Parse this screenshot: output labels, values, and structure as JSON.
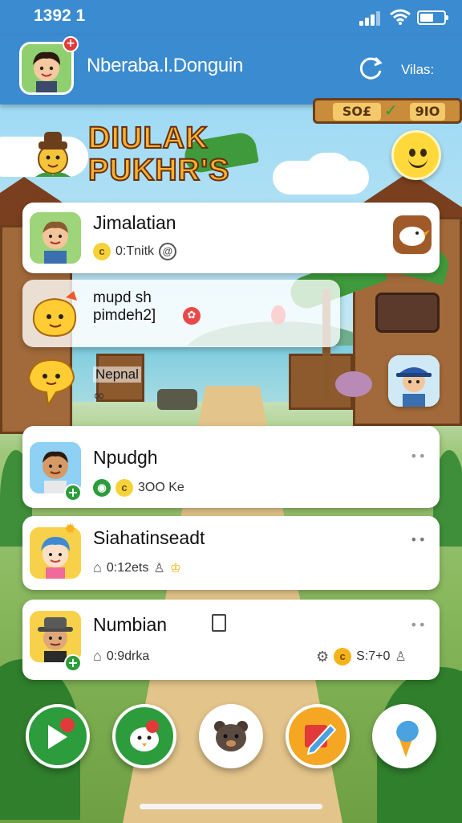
{
  "status_bar": {
    "time": "1392 1"
  },
  "header": {
    "title": "Nberaba.l.Donguin",
    "right_label": "Vilas:",
    "badge": "+"
  },
  "banner": {
    "logo_line1": "DIULAK",
    "logo_line2": "PUKHR'S",
    "score_left": "SO£",
    "score_right": "9IO"
  },
  "cards": [
    {
      "title": "Jimalatian",
      "subtitle": "0:Tnitk"
    },
    {
      "title_line1": "mupd sh",
      "title_line2": "pimdeh2]"
    },
    {
      "title": "Nepnal"
    },
    {
      "title": "Npudgh",
      "subtitle": "3OO Ke",
      "more": "••"
    },
    {
      "title": "Siahatinseadt",
      "subtitle": "0:12ets",
      "more": "••"
    },
    {
      "title": "Numbian",
      "subtitle": "0:9drka",
      "stat": "S:7+0",
      "more": "••"
    }
  ],
  "colors": {
    "header_blue": "#3b8bd0",
    "green_button": "#2c9c3c",
    "orange_button": "#f5a623",
    "badge_red": "#e23a3a"
  },
  "nav": {
    "icons": [
      "play-icon",
      "chicken-icon",
      "bear-icon",
      "pencil-icon",
      "ice-cream-icon"
    ]
  }
}
